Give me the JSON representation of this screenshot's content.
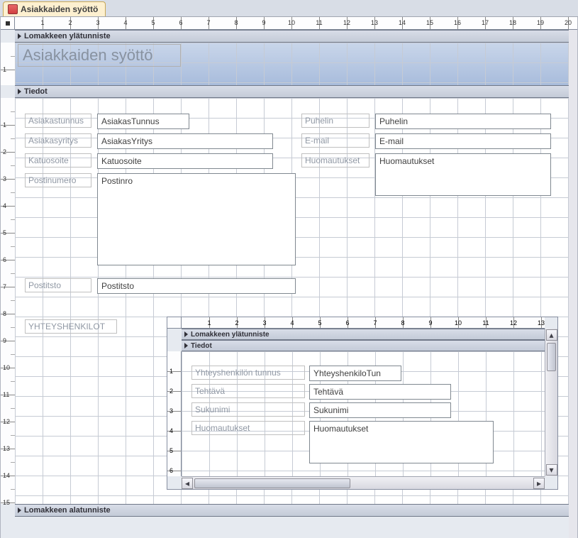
{
  "tab": {
    "label": "Asiakkaiden syöttö"
  },
  "main_form": {
    "header_section_label": "Lomakkeen ylätunniste",
    "detail_section_label": "Tiedot",
    "footer_section_label": "Lomakkeen alatunniste",
    "title": "Asiakkaiden syöttö",
    "fields_left": [
      {
        "label": "Asiakastunnus",
        "control": "AsiakasTunnus"
      },
      {
        "label": "Asiakasyritys",
        "control": "AsiakasYritys"
      },
      {
        "label": "Katuosoite",
        "control": "Katuosoite"
      },
      {
        "label": "Postinumero",
        "control": "Postinro"
      },
      {
        "label": "Postitsto",
        "control": "Postitsto"
      }
    ],
    "fields_right": [
      {
        "label": "Puhelin",
        "control": "Puhelin"
      },
      {
        "label": "E-mail",
        "control": "E-mail"
      },
      {
        "label": "Huomautukset",
        "control": "Huomautukset"
      }
    ],
    "contact_section_label": "YHTEYSHENKILOT"
  },
  "subform": {
    "header_section_label": "Lomakkeen ylätunniste",
    "detail_section_label": "Tiedot",
    "fields": [
      {
        "label": "Yhteyshenkilön tunnus",
        "control": "YhteyshenkiloTun"
      },
      {
        "label": "Tehtävä",
        "control": "Tehtävä"
      },
      {
        "label": "Sukunimi",
        "control": "Sukunimi"
      },
      {
        "label": "Huomautukset",
        "control": "Huomautukset"
      }
    ]
  },
  "ruler_main_max": 20,
  "ruler_sub_max": 13
}
